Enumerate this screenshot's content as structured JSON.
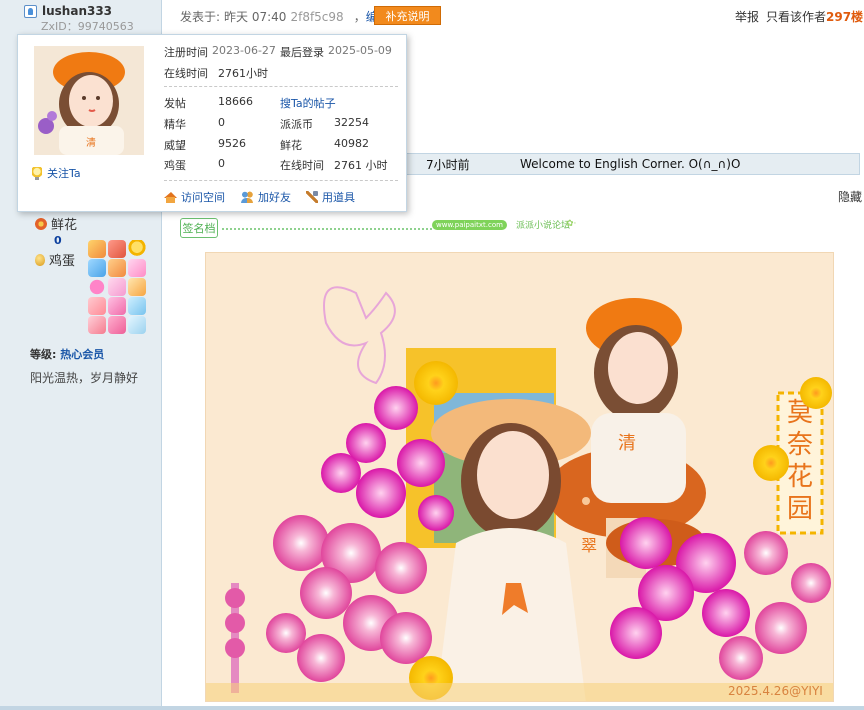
{
  "user": {
    "name": "lushan333",
    "zxid": "ZxID：99740563"
  },
  "sidebar": {
    "flower_label": "鲜花",
    "flower_value": "0",
    "egg_label": "鸡蛋",
    "level_label": "等级:",
    "level_value": "热心会员",
    "motto": "阳光温热，岁月静好"
  },
  "popup": {
    "follow": "关注Ta",
    "register_label": "注册时间",
    "register_value": "2023-06-27",
    "lastlogin_label": "最后登录",
    "lastlogin_value": "2025-05-09",
    "online_label": "在线时间",
    "online_value": "2761小时",
    "stats": [
      {
        "label": "发帖",
        "value": "18666",
        "label2": "搜Ta的帖子",
        "value2": ""
      },
      {
        "label": "精华",
        "value": "0",
        "label2": "派派币",
        "value2": "32254"
      },
      {
        "label": "威望",
        "value": "9526",
        "label2": "鲜花",
        "value2": "40982"
      },
      {
        "label": "鸡蛋",
        "value": "0",
        "label2": "在线时间",
        "value2": "2761 小时"
      }
    ],
    "actions": {
      "visit": "访问空间",
      "add_friend": "加好友",
      "use_item": "用道具"
    }
  },
  "post": {
    "posted_prefix": "发表于:",
    "posted_time": "昨天 07:40",
    "hash": "2f8f5c98",
    "sep": "，",
    "edit": "编辑",
    "supplement": "补充说明",
    "report": "举报",
    "author_only": "只看该作者",
    "floor": "297楼"
  },
  "rate": {
    "time": "7小时前",
    "message": "Welcome to English Corner. O(∩_∩)O"
  },
  "hide": "隐藏",
  "signature": {
    "tag": "签名档",
    "pill": "www.paipaitxt.com",
    "text": "派派小说论坛",
    "dots": "✿·"
  },
  "artwork": {
    "caption": "2025.4.26@YIYI",
    "vertical_text": [
      "莫",
      "奈",
      "花",
      "园"
    ],
    "apron_text": "清",
    "apron_text2": "翠"
  },
  "colors": {
    "accent_orange": "#f28a1d",
    "link_blue": "#1a56a8",
    "floor_orange": "#e05b0d",
    "sidebar_bg": "#e5edf2"
  }
}
